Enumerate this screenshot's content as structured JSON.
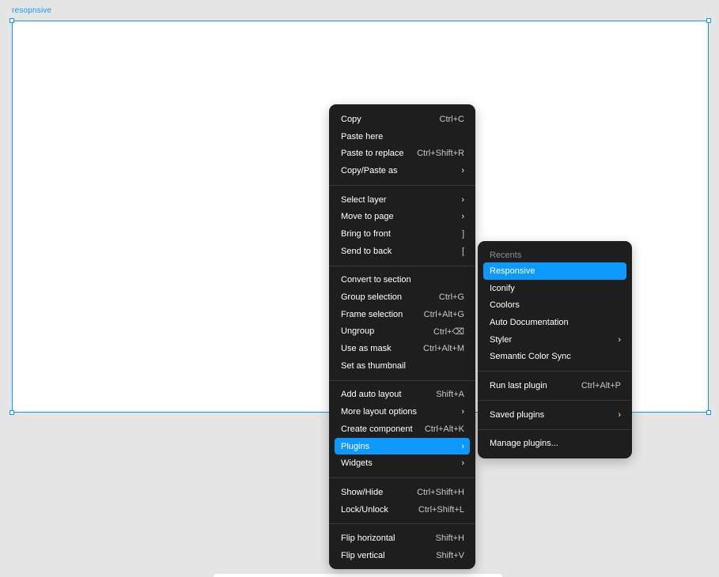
{
  "canvas": {
    "frame_label": "resopnsive"
  },
  "context_menu": {
    "groups": [
      [
        {
          "label": "Copy",
          "shortcut": "Ctrl+C"
        },
        {
          "label": "Paste here",
          "shortcut": ""
        },
        {
          "label": "Paste to replace",
          "shortcut": "Ctrl+Shift+R"
        },
        {
          "label": "Copy/Paste as",
          "shortcut": "›"
        }
      ],
      [
        {
          "label": "Select layer",
          "shortcut": "›"
        },
        {
          "label": "Move to page",
          "shortcut": "›"
        },
        {
          "label": "Bring to front",
          "shortcut": "]"
        },
        {
          "label": "Send to back",
          "shortcut": "["
        }
      ],
      [
        {
          "label": "Convert to section",
          "shortcut": ""
        },
        {
          "label": "Group selection",
          "shortcut": "Ctrl+G"
        },
        {
          "label": "Frame selection",
          "shortcut": "Ctrl+Alt+G"
        },
        {
          "label": "Ungroup",
          "shortcut": "Ctrl+⌫"
        },
        {
          "label": "Use as mask",
          "shortcut": "Ctrl+Alt+M"
        },
        {
          "label": "Set as thumbnail",
          "shortcut": ""
        }
      ],
      [
        {
          "label": "Add auto layout",
          "shortcut": "Shift+A"
        },
        {
          "label": "More layout options",
          "shortcut": "›"
        },
        {
          "label": "Create component",
          "shortcut": "Ctrl+Alt+K"
        },
        {
          "label": "Plugins",
          "shortcut": "›",
          "active": true
        },
        {
          "label": "Widgets",
          "shortcut": "›"
        }
      ],
      [
        {
          "label": "Show/Hide",
          "shortcut": "Ctrl+Shift+H"
        },
        {
          "label": "Lock/Unlock",
          "shortcut": "Ctrl+Shift+L"
        }
      ],
      [
        {
          "label": "Flip horizontal",
          "shortcut": "Shift+H"
        },
        {
          "label": "Flip vertical",
          "shortcut": "Shift+V"
        }
      ]
    ]
  },
  "plugins_menu": {
    "recents_heading": "Recents",
    "recents": [
      {
        "label": "Responsive",
        "shortcut": "",
        "active": true
      },
      {
        "label": "Iconify",
        "shortcut": ""
      },
      {
        "label": "Coolors",
        "shortcut": ""
      },
      {
        "label": "Auto Documentation",
        "shortcut": ""
      },
      {
        "label": "Styler",
        "shortcut": "›"
      },
      {
        "label": "Semantic Color Sync",
        "shortcut": ""
      }
    ],
    "run_last": {
      "label": "Run last plugin",
      "shortcut": "Ctrl+Alt+P"
    },
    "saved": {
      "label": "Saved plugins",
      "shortcut": "›"
    },
    "manage": {
      "label": "Manage plugins...",
      "shortcut": ""
    }
  },
  "colors": {
    "accent": "#0d99ff",
    "menu_bg": "#1e1e1e",
    "canvas_bg": "#e5e5e5"
  }
}
